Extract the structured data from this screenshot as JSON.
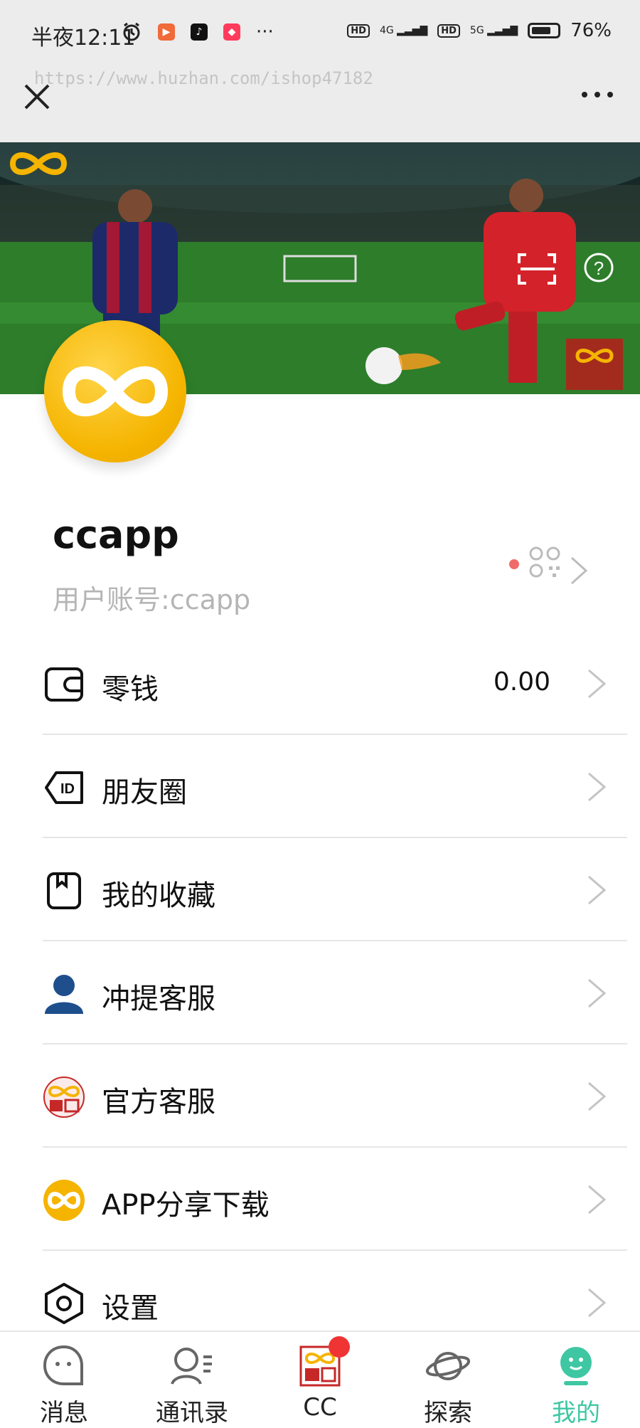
{
  "status_bar": {
    "time": "半夜12:11",
    "signal_1": "4G",
    "signal_2": "5G",
    "hd": "HD",
    "battery_percent": "76%",
    "battery_level": 0.76,
    "more": "···"
  },
  "browser": {
    "url_watermark": "https://www.huzhan.com/ishop47182",
    "close_icon": "close-icon",
    "more_icon": "more-icon"
  },
  "profile": {
    "name": "ccapp",
    "account": "用户账号:ccapp"
  },
  "menu": {
    "items": [
      {
        "label": "零钱",
        "value": "0.00",
        "icon": "wallet-icon"
      },
      {
        "label": "朋友圈",
        "icon": "id-tag-icon"
      },
      {
        "label": "我的收藏",
        "icon": "bookmark-icon"
      },
      {
        "label": "冲提客服",
        "icon": "user-icon"
      },
      {
        "label": "官方客服",
        "icon": "official-seal-icon"
      },
      {
        "label": "APP分享下载",
        "icon": "app-logo-icon"
      },
      {
        "label": "设置",
        "icon": "settings-icon"
      }
    ]
  },
  "tabs": [
    {
      "label": "消息",
      "icon": "message-icon"
    },
    {
      "label": "通讯录",
      "icon": "contacts-icon"
    },
    {
      "label": "CC",
      "icon": "cc-platform-icon"
    },
    {
      "label": "探索",
      "icon": "planet-icon"
    },
    {
      "label": "我的",
      "icon": "me-icon",
      "active": true
    }
  ],
  "colors": {
    "accent": "#3ec7a2",
    "brand_yellow": "#f5b400",
    "badge_red": "#f03434"
  }
}
